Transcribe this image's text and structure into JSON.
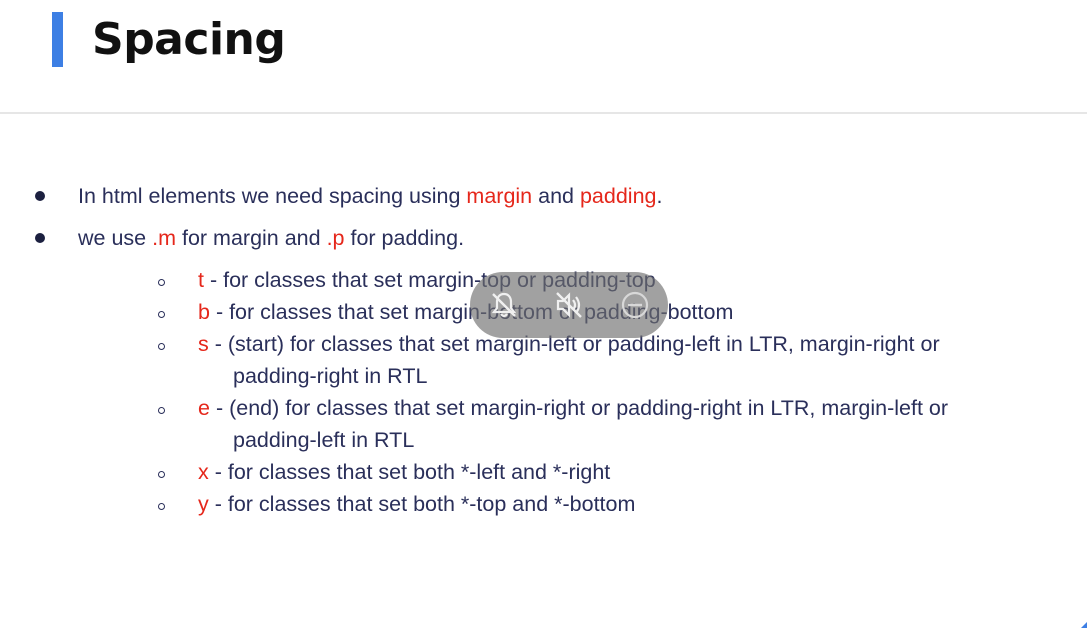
{
  "header": {
    "title": "Spacing"
  },
  "bullets": [
    {
      "segments": [
        {
          "text": "In html elements we need spacing using ",
          "highlight": false
        },
        {
          "text": "margin",
          "highlight": true
        },
        {
          "text": " and ",
          "highlight": false
        },
        {
          "text": "padding",
          "highlight": true
        },
        {
          "text": ".",
          "highlight": false
        }
      ]
    },
    {
      "segments": [
        {
          "text": "we use ",
          "highlight": false
        },
        {
          "text": ".m",
          "highlight": true
        },
        {
          "text": " for margin and ",
          "highlight": false
        },
        {
          "text": ".p",
          "highlight": true
        },
        {
          "text": " for padding.",
          "highlight": false
        }
      ]
    }
  ],
  "sub_items": [
    {
      "key": "t",
      "text": " - for classes that set margin-top or padding-top",
      "continuation": ""
    },
    {
      "key": "b",
      "text": " - for classes that set margin-bottom or padding-bottom",
      "continuation": ""
    },
    {
      "key": "s",
      "text": " - (start) for classes that set margin-left or padding-left in LTR, margin-right or",
      "continuation": "padding-right in RTL"
    },
    {
      "key": "e",
      "text": " - (end) for classes that set margin-right or padding-right in LTR, margin-left or",
      "continuation": "padding-left in RTL"
    },
    {
      "key": "x",
      "text": " - for classes that set both *-left and *-right",
      "continuation": ""
    },
    {
      "key": "y",
      "text": " - for classes that set both *-top and *-bottom",
      "continuation": ""
    }
  ],
  "overlay": {
    "icons": [
      "bell-off-icon",
      "volume-off-icon",
      "do-not-disturb-icon"
    ]
  },
  "colors": {
    "accent": "#3d7fe4",
    "highlight": "#e5271b",
    "text": "#2a2f5a",
    "title": "#111111"
  }
}
